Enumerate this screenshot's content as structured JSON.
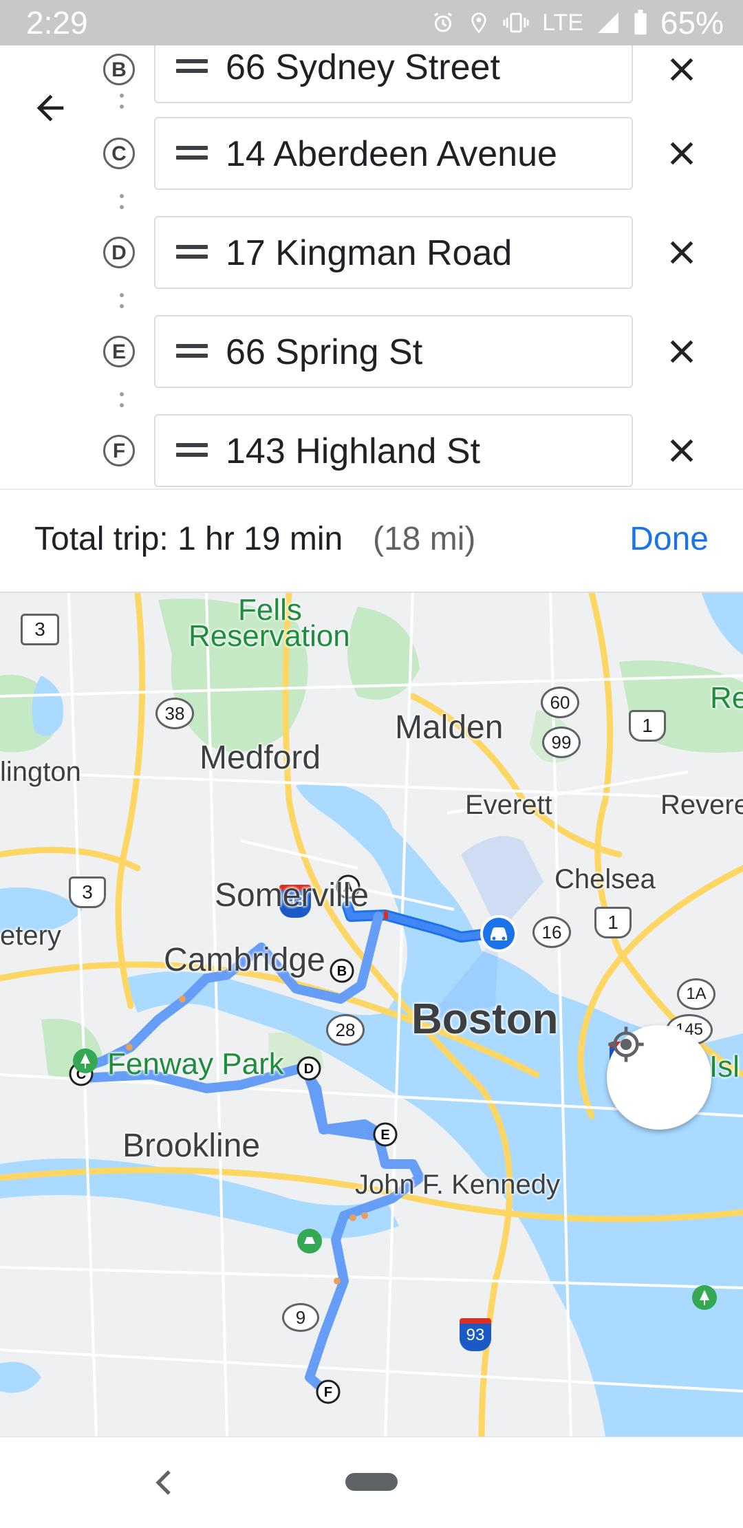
{
  "status_bar": {
    "time": "2:29",
    "network": "LTE",
    "battery": "65%"
  },
  "stops": [
    {
      "letter": "B",
      "address": "66 Sydney Street"
    },
    {
      "letter": "C",
      "address": "14 Aberdeen Avenue"
    },
    {
      "letter": "D",
      "address": "17 Kingman Road"
    },
    {
      "letter": "E",
      "address": "66 Spring St"
    },
    {
      "letter": "F",
      "address": "143 Highland St"
    }
  ],
  "summary": {
    "total_label": "Total trip: 1 hr 19 min",
    "distance": "(18 mi)",
    "done_label": "Done"
  },
  "map": {
    "places": {
      "fells": "Fells",
      "reservation": "Reservation",
      "malden": "Malden",
      "medford": "Medford",
      "arlington": "lington",
      "everett": "Everett",
      "revere": "Revere",
      "chelsea": "Chelsea",
      "somerville": "Somerville",
      "cemetery": "etery",
      "cambridge": "Cambridge",
      "boston": "Boston",
      "fenway": "Fenway Park",
      "castle": "Castle Isl",
      "brookline": "Brookline",
      "jfk": "John F. Kennedy",
      "re_top": "Re"
    },
    "shields": [
      "3",
      "38",
      "60",
      "99",
      "1",
      "93",
      "3",
      "16",
      "1",
      "1A",
      "145",
      "28",
      "90",
      "93",
      "9"
    ],
    "route_markers": [
      "A",
      "B",
      "C",
      "D",
      "E",
      "F"
    ],
    "colors": {
      "route": "#669df6",
      "route_outline": "#1a73e8",
      "water": "#aadaff",
      "park": "#c5e8c5",
      "highway": "#fdd663"
    }
  },
  "icons": {
    "back": "arrow-back-icon",
    "remove": "close-icon",
    "drag": "drag-handle-icon",
    "locate": "my-location-icon",
    "car": "car-icon"
  }
}
